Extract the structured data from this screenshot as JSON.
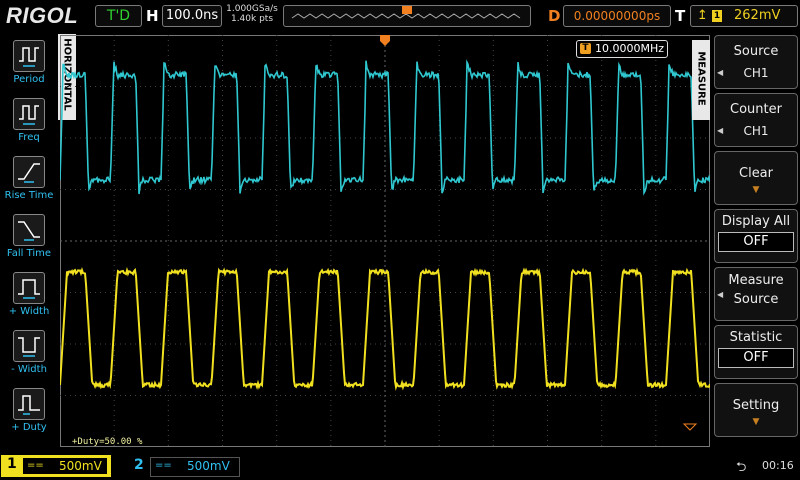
{
  "brand": "RIGOL",
  "top": {
    "run_status": "T'D",
    "h_label": "H",
    "timebase": "100.0ns",
    "sample_rate": "1.000GSa/s",
    "memory_depth": "1.40k pts",
    "d_label": "D",
    "delay": "0.00000000ps",
    "t_label": "T",
    "trigger_source": "1",
    "trigger_level": "262mV"
  },
  "left_panel": {
    "tab_label": "HORIZONTAL",
    "items": [
      {
        "label": "Period",
        "icon": "period-icon"
      },
      {
        "label": "Freq",
        "icon": "frequency-icon"
      },
      {
        "label": "Rise Time",
        "icon": "rise-time-icon"
      },
      {
        "label": "Fall Time",
        "icon": "fall-time-icon"
      },
      {
        "label": "+ Width",
        "icon": "positive-width-icon"
      },
      {
        "label": "- Width",
        "icon": "negative-width-icon"
      },
      {
        "label": "+ Duty",
        "icon": "positive-duty-icon"
      }
    ]
  },
  "right_menu": {
    "tab_label": "MEASURE",
    "source_label": "Source",
    "source_value": "CH1",
    "counter_label": "Counter",
    "counter_value": "CH1",
    "clear_label": "Clear",
    "display_all_label": "Display All",
    "display_all_value": "OFF",
    "measure_source_line1": "Measure",
    "measure_source_line2": "Source",
    "statistic_label": "Statistic",
    "statistic_value": "OFF",
    "setting_label": "Setting"
  },
  "screen": {
    "frequency_counter_badge": "T",
    "frequency_counter": "10.0000MHz",
    "duty_readout": "+Duty=50.00 %"
  },
  "bottom": {
    "ch1_number": "1",
    "ch1_coupling": "==",
    "ch1_scale": "500mV",
    "ch2_number": "2",
    "ch2_coupling": "==",
    "ch2_scale": "500mV",
    "clock": "00:16"
  },
  "colors": {
    "ch1": "#f0e020",
    "ch2": "#30c8d0",
    "menu_accent": "#30c0f0",
    "trigger": "#f08020"
  }
}
